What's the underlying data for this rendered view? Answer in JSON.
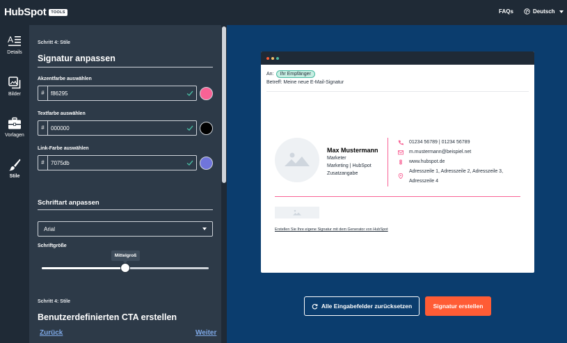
{
  "brand": {
    "logo_text": "HubSpot",
    "logo_badge": "TOOLS"
  },
  "topbar": {
    "faqs": "FAQs",
    "language": "Deutsch"
  },
  "rail": {
    "items": [
      {
        "label": "Details",
        "icon": "details-icon",
        "active": false
      },
      {
        "label": "Bilder",
        "icon": "images-icon",
        "active": false
      },
      {
        "label": "Vorlagen",
        "icon": "briefcase-icon",
        "active": false
      },
      {
        "label": "Stile",
        "icon": "brush-icon",
        "active": true
      }
    ]
  },
  "form": {
    "step_label": "Schritt 4: Stile",
    "title": "Signatur anpassen",
    "accent": {
      "label": "Akzentfarbe auswählen",
      "prefix": "#",
      "value": "f86295",
      "color": "#f86295"
    },
    "text": {
      "label": "Textfarbe auswählen",
      "prefix": "#",
      "value": "000000",
      "color": "#000000"
    },
    "link": {
      "label": "Link-Farbe auswählen",
      "prefix": "#",
      "value": "7075db",
      "color": "#7075db"
    },
    "font_section_title": "Schriftart anpassen",
    "font_select_value": "Arial",
    "font_size_label": "Schriftgröße",
    "font_size_tooltip": "Mittelgroß",
    "font_size_fraction": 0.5,
    "cta_step_label": "Schritt 4: Stile",
    "cta_title": "Benutzerdefinierten CTA erstellen",
    "back_link": "Zurück",
    "next_link": "Weiter"
  },
  "email": {
    "to_label": "An:",
    "recipient_badge": "Ihr Empfänger",
    "subject": "Betreff: Meine neue E-Mail-Signatur"
  },
  "signature": {
    "name": "Max Mustermann",
    "job_title": "Marketer",
    "department": "Marketing | HubSpot",
    "extra": "Zusatzangabe",
    "phone": "01234 56789 | 01234 56789",
    "email": "m.mustermann@beispiel.net",
    "website": "www.hubspot.de",
    "address_line1": "Adresszeile 1, Adresszeile 2, Adresszeile 3,",
    "address_line2": "Adresszeile 4",
    "generator_link": "Erstellen Sie Ihre eigene Signatur mit dem Generator von HubSpot"
  },
  "actions": {
    "reset_label": "Alle Eingabefelder zurücksetzen",
    "create_label": "Signatur erstellen"
  },
  "colors": {
    "accent": "#f86295",
    "cta_orange": "#ff5c35",
    "preview_bg": "#0b3d6e",
    "panel_bg": "#2d3a48",
    "dark_bg": "#1f2a36"
  }
}
